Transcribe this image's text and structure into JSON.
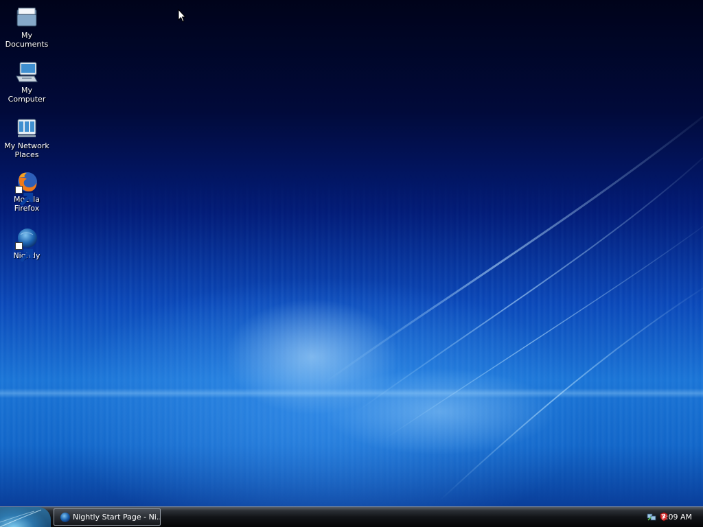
{
  "desktop": {
    "icons": [
      {
        "label_line1": "My",
        "label_line2": "Documents",
        "icon": "folder-documents-icon"
      },
      {
        "label_line1": "My",
        "label_line2": "Computer",
        "icon": "computer-icon"
      },
      {
        "label_line1": "My Network",
        "label_line2": "Places",
        "icon": "network-places-icon"
      },
      {
        "label_line1": "Mozilla",
        "label_line2": "Firefox",
        "icon": "firefox-icon",
        "shortcut": true
      },
      {
        "label_line1": "Nightly",
        "label_line2": "",
        "icon": "nightly-icon",
        "shortcut": true
      }
    ]
  },
  "taskbar": {
    "start_button_icon": "start-orb-icon",
    "task_button_label": "Nightly Start Page - Ni...",
    "task_button_icon": "nightly-icon",
    "tray_icons": [
      "network-tray-icon",
      "security-shield-tray-icon"
    ],
    "clock": "7:09 AM"
  },
  "colors": {
    "desktop_top": "#00031a",
    "desktop_mid": "#0a47b8",
    "desktop_glow": "#1a74d6",
    "taskbar": "#121418",
    "text": "#ffffff"
  }
}
